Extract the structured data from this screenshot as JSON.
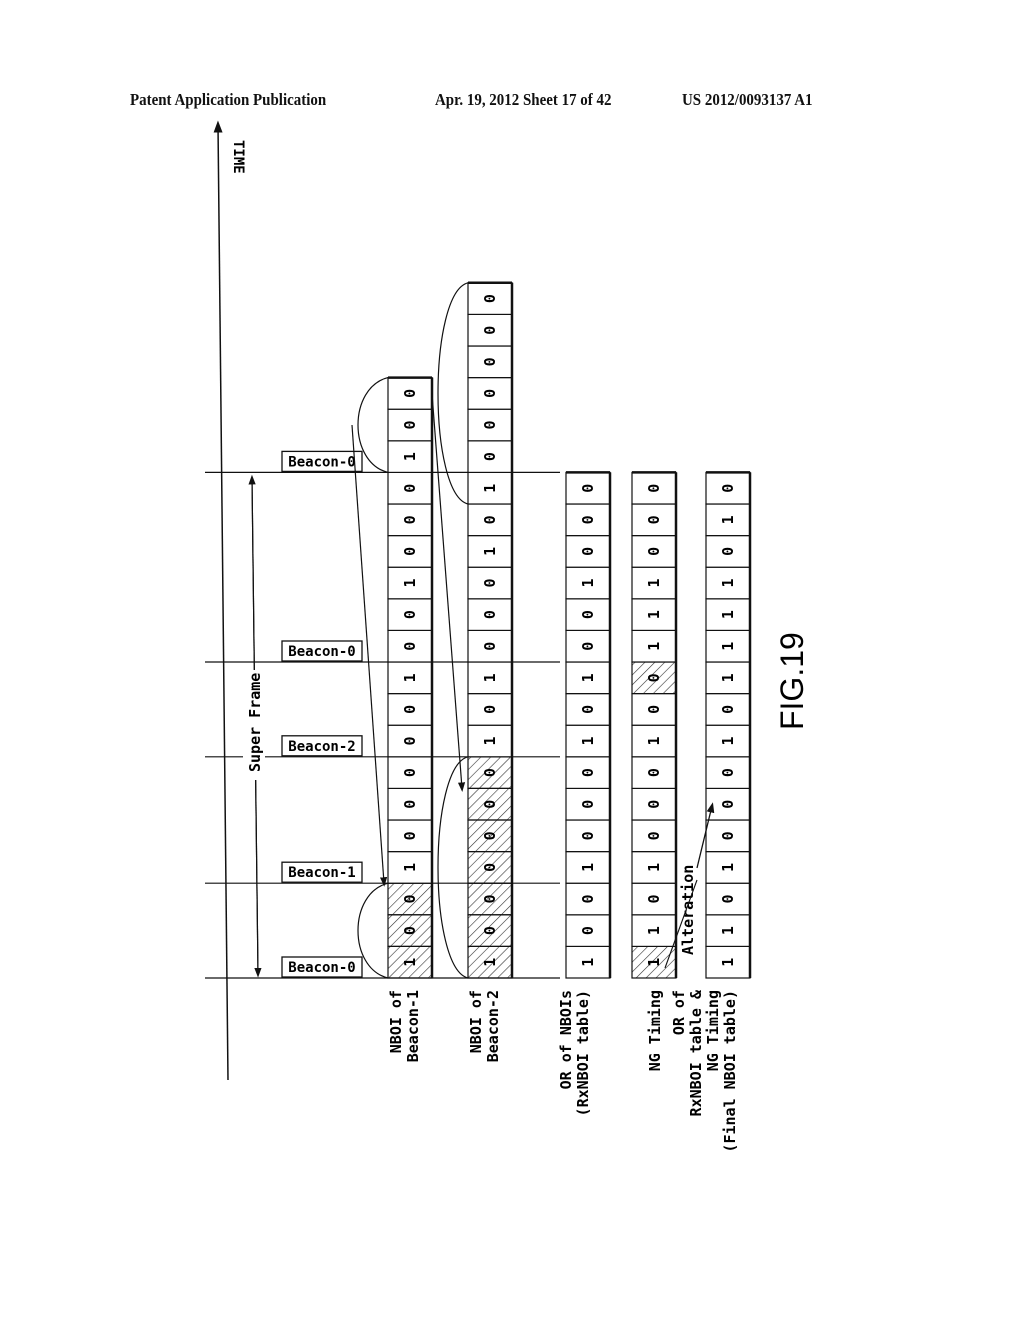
{
  "header": {
    "publication": "Patent Application Publication",
    "date_sheet": "Apr. 19, 2012  Sheet 17 of 42",
    "number": "US 2012/0093137 A1"
  },
  "figure": {
    "label": "FIG.19",
    "time_axis_label": "TIME",
    "super_frame_label": "Super Frame",
    "alteration_label": "Alteration",
    "beacons": [
      {
        "label": "Beacon-0",
        "slot": 0
      },
      {
        "label": "Beacon-1",
        "slot": 3
      },
      {
        "label": "Beacon-2",
        "slot": 7
      },
      {
        "label": "Beacon-0",
        "slot": 10
      },
      {
        "label": "Beacon-0",
        "slot": 16
      }
    ],
    "rows": [
      {
        "label_lines": [
          "NBOI of",
          "Beacon-1"
        ],
        "bits": [
          1,
          0,
          0,
          1,
          0,
          0,
          0,
          0,
          0,
          1,
          0,
          0,
          1,
          0,
          0,
          0,
          1,
          0,
          0
        ],
        "hatched": [
          0,
          1,
          2
        ],
        "start_slot": 0
      },
      {
        "label_lines": [
          "NBOI of",
          "Beacon-2"
        ],
        "bits": [
          1,
          0,
          0,
          0,
          0,
          0,
          0,
          1,
          0,
          1,
          0,
          0,
          0,
          1,
          0,
          1,
          0,
          0,
          0,
          0,
          0,
          0
        ],
        "hatched": [
          0,
          1,
          2,
          3,
          4,
          5,
          6
        ],
        "start_slot": 0
      },
      {
        "label_lines": [
          "OR of NBOIs",
          "(RxNBOI table)"
        ],
        "bits": [
          1,
          0,
          0,
          1,
          0,
          0,
          0,
          1,
          0,
          1,
          0,
          0,
          1,
          0,
          0,
          0
        ],
        "hatched": [],
        "start_slot": 0
      },
      {
        "label_lines": [
          "NG Timing"
        ],
        "bits": [
          1,
          1,
          0,
          1,
          0,
          0,
          0,
          1,
          0,
          0,
          1,
          1,
          1,
          0,
          0,
          0
        ],
        "hatched": [
          0,
          9
        ],
        "start_slot": 0
      },
      {
        "label_lines": [
          "OR of",
          "RxNBOI table &",
          "NG Timing",
          "(Final NBOI table)"
        ],
        "bits": [
          1,
          1,
          0,
          1,
          0,
          0,
          0,
          1,
          0,
          1,
          1,
          1,
          1,
          0,
          1,
          0
        ],
        "hatched": [],
        "start_slot": 0
      }
    ]
  }
}
